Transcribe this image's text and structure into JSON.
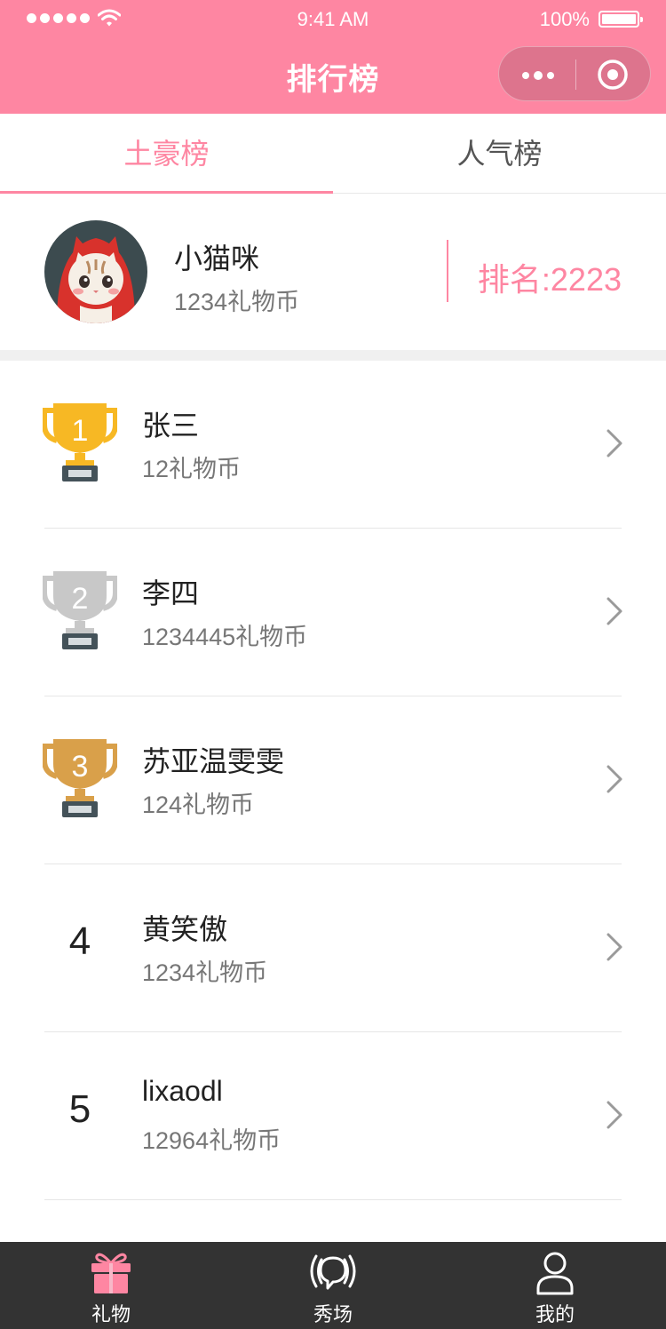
{
  "status_bar": {
    "time": "9:41 AM",
    "battery": "100%"
  },
  "header": {
    "title": "排行榜"
  },
  "tabs": [
    {
      "label": "土豪榜",
      "active": true
    },
    {
      "label": "人气榜",
      "active": false
    }
  ],
  "me": {
    "name": "小猫咪",
    "coins": "1234礼物币",
    "rank_text": "排名:2223"
  },
  "ranking": [
    {
      "rank": "1",
      "badge": "gold-trophy",
      "name": "张三",
      "coins": "12礼物币"
    },
    {
      "rank": "2",
      "badge": "silver-trophy",
      "name": "李四",
      "coins": "1234445礼物币"
    },
    {
      "rank": "3",
      "badge": "bronze-trophy",
      "name": "苏亚温雯雯",
      "coins": "124礼物币"
    },
    {
      "rank": "4",
      "badge": "",
      "name": "黄笑傲",
      "coins": "1234礼物币"
    },
    {
      "rank": "5",
      "badge": "",
      "name": "lixaodl",
      "coins": "12964礼物币"
    }
  ],
  "tabbar": [
    {
      "label": "礼物",
      "icon": "gift-icon",
      "active": true
    },
    {
      "label": "秀场",
      "icon": "live-icon",
      "active": false
    },
    {
      "label": "我的",
      "icon": "user-icon",
      "active": false
    }
  ],
  "colors": {
    "accent": "#fe86a2",
    "gold": "#f7b824",
    "silver": "#c8c8c8",
    "bronze": "#d9a04a",
    "tabbar": "#333333"
  }
}
